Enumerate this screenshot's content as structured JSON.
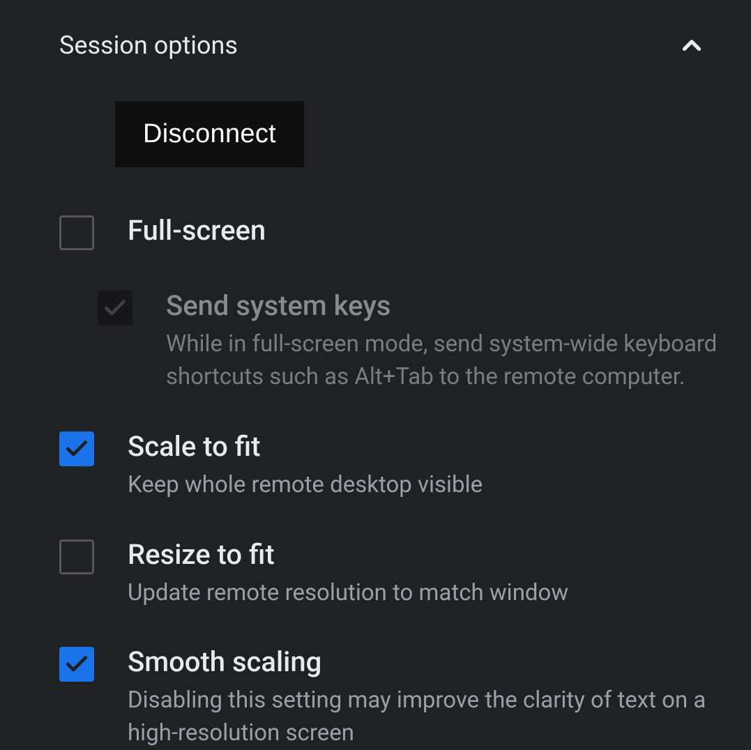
{
  "section": {
    "title": "Session options"
  },
  "actions": {
    "disconnect_label": "Disconnect"
  },
  "options": {
    "fullscreen": {
      "label": "Full-screen",
      "checked": false,
      "disabled": false
    },
    "send_system_keys": {
      "label": "Send system keys",
      "description": "While in full-screen mode, send system-wide keyboard shortcuts such as Alt+Tab to the remote computer.",
      "checked": true,
      "disabled": true
    },
    "scale_to_fit": {
      "label": "Scale to fit",
      "description": "Keep whole remote desktop visible",
      "checked": true,
      "disabled": false
    },
    "resize_to_fit": {
      "label": "Resize to fit",
      "description": "Update remote resolution to match window",
      "checked": false,
      "disabled": false
    },
    "smooth_scaling": {
      "label": "Smooth scaling",
      "description": "Disabling this setting may improve the clarity of text on a high-resolution screen",
      "checked": true,
      "disabled": false
    }
  }
}
